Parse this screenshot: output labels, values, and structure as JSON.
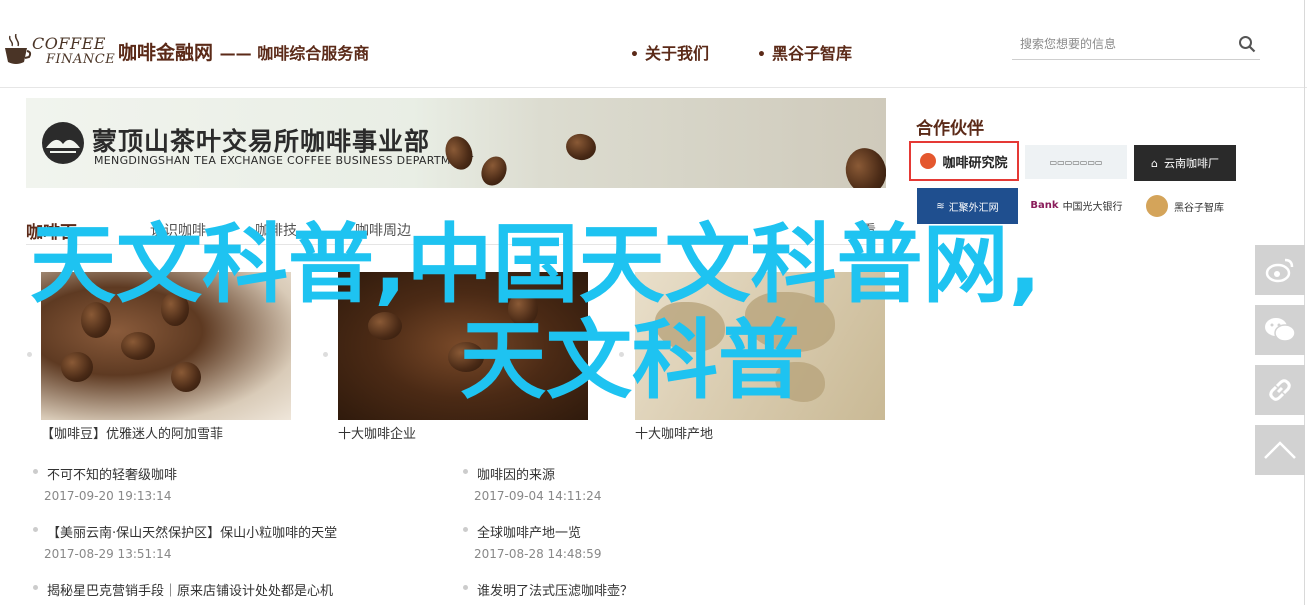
{
  "header": {
    "logo_word1": "COFFEE",
    "logo_word2": "FINANCE",
    "site_name": "咖啡金融网",
    "site_slogan": "—— 咖啡综合服务商",
    "nav": [
      "关于我们",
      "黑谷子智库"
    ],
    "search_placeholder": "搜索您想要的信息"
  },
  "banner": {
    "title_cn": "蒙顶山茶叶交易所咖啡事业部",
    "title_en": "MENGDINGSHAN TEA EXCHANGE COFFEE BUSINESS DEPARTMENT"
  },
  "partners": {
    "title": "合作伙伴",
    "logos": [
      "咖啡研究院",
      "云南咖啡厂",
      "汇聚外汇网",
      "中国光大银行",
      "黑谷子智库"
    ],
    "logo_bank_prefix": "Bank"
  },
  "section": {
    "title": "咖啡百",
    "tabs": [
      "认识咖啡",
      "咖啡技",
      "咖啡周边",
      "看"
    ]
  },
  "cards": [
    {
      "caption": "【咖啡豆】优雅迷人的阿加雪菲"
    },
    {
      "caption": "十大咖啡企业"
    },
    {
      "caption": "十大咖啡产地"
    }
  ],
  "articles_left": [
    {
      "title": "不可不知的轻奢级咖啡",
      "date": "2017-09-20 19:13:14"
    },
    {
      "title": "【美丽云南·保山天然保护区】保山小粒咖啡的天堂",
      "date": "2017-08-29 13:51:14"
    },
    {
      "title": "揭秘星巴克营销手段｜原来店铺设计处处都是心机",
      "date": ""
    }
  ],
  "articles_right": [
    {
      "title": "咖啡因的来源",
      "date": "2017-09-04 14:11:24"
    },
    {
      "title": "全球咖啡产地一览",
      "date": "2017-08-28 14:48:59"
    },
    {
      "title": "谁发明了法式压滤咖啡壶？",
      "date": ""
    }
  ],
  "watermark": {
    "line1": "天文科普,中国天文科普网,",
    "line2": "天文科普"
  },
  "colors": {
    "brand_brown": "#5b2a18",
    "watermark_cyan": "#1ec3f1",
    "side_button_gray": "#d2d2d2",
    "partner_highlight": "#e53935"
  },
  "side_buttons": [
    "weibo-icon",
    "wechat-icon",
    "link-icon",
    "back-to-top-icon"
  ]
}
